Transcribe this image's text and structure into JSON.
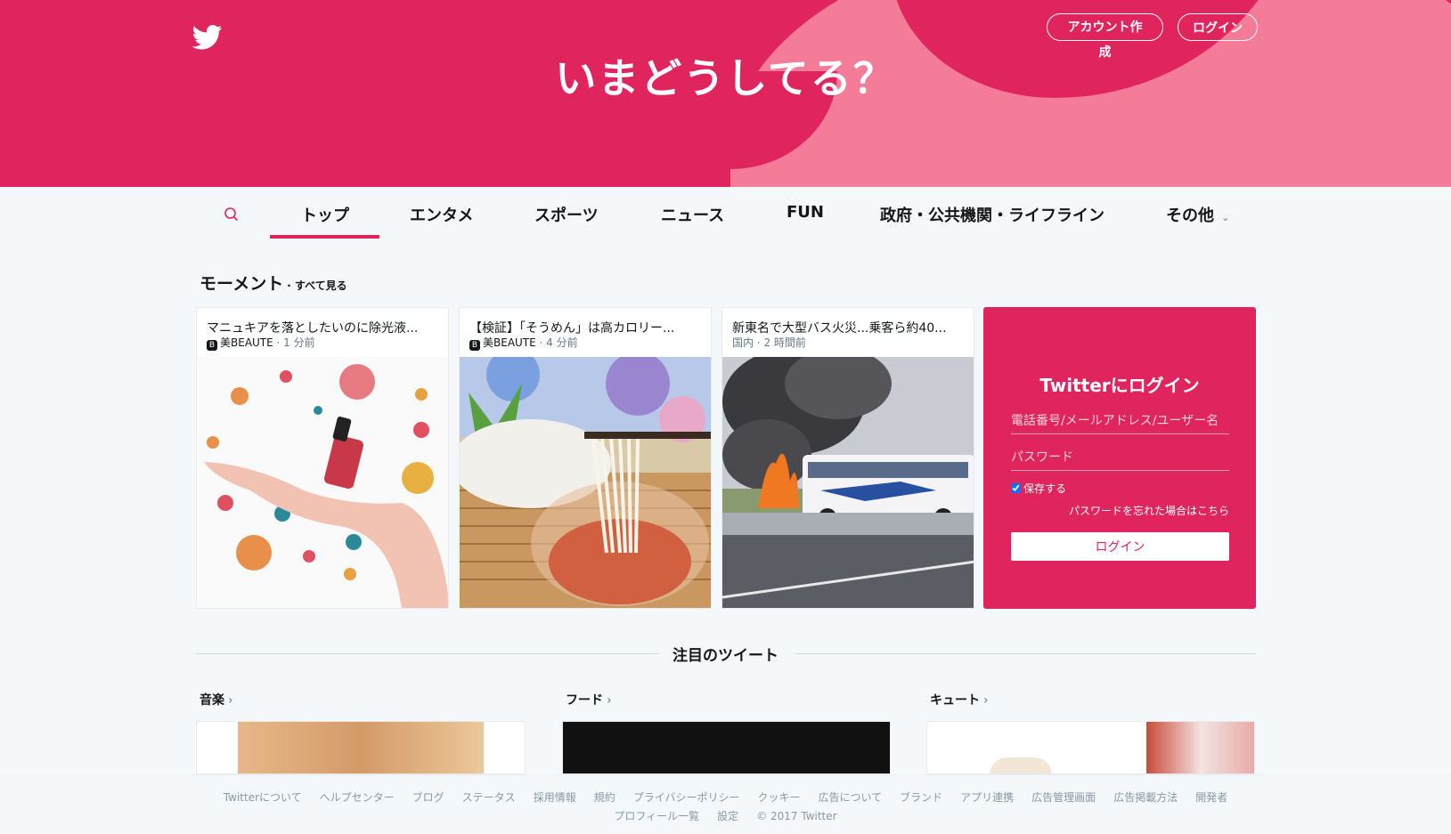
{
  "header": {
    "headline": "いまどうしてる？",
    "signup_label": "アカウント作成",
    "login_label": "ログイン"
  },
  "nav": {
    "items": [
      {
        "label": "トップ"
      },
      {
        "label": "エンタメ"
      },
      {
        "label": "スポーツ"
      },
      {
        "label": "ニュース"
      },
      {
        "label": "FUN"
      },
      {
        "label": "政府・公共機関・ライフライン"
      },
      {
        "label": "その他"
      }
    ],
    "more_chevron": "⌄"
  },
  "moments": {
    "title": "モーメント",
    "see_all": "· すべて見る",
    "cards": [
      {
        "title": "マニュキアを落としたいのに除光液...",
        "badge": "B",
        "source": "美BEAUTE",
        "time": " · 1 分前"
      },
      {
        "title": "【検証】「そうめん」は高カロリー...",
        "badge": "B",
        "source": "美BEAUTE",
        "time": " · 4 分前"
      },
      {
        "title": "新東名で大型バス火災...乗客ら約40...",
        "badge": "",
        "source": "国内",
        "time": " · 2 時間前"
      }
    ]
  },
  "login": {
    "title": "Twitterにログイン",
    "username_placeholder": "電話番号/メールアドレス/ユーザー名",
    "password_placeholder": "パスワード",
    "remember_label": "保存する",
    "forgot_label": "パスワードを忘れた場合はこちら",
    "submit_label": "ログイン"
  },
  "featured": {
    "title": "注目のツイート",
    "categories": [
      {
        "label": "音楽",
        "chev": "›"
      },
      {
        "label": "フード",
        "chev": "›"
      },
      {
        "label": "キュート",
        "chev": "›"
      }
    ]
  },
  "footer": {
    "links_row1": [
      "Twitterについて",
      "ヘルプセンター",
      "ブログ",
      "ステータス",
      "採用情報",
      "規約",
      "プライバシーポリシー",
      "クッキー",
      "広告について",
      "ブランド",
      "アプリ連携",
      "広告管理画面",
      "広告掲載方法",
      "開発者"
    ],
    "links_row2": [
      "プロフィール一覧",
      "設定",
      "© 2017 Twitter"
    ]
  },
  "colors": {
    "brand": "#e0245e",
    "brand_light": "#f47c98"
  }
}
